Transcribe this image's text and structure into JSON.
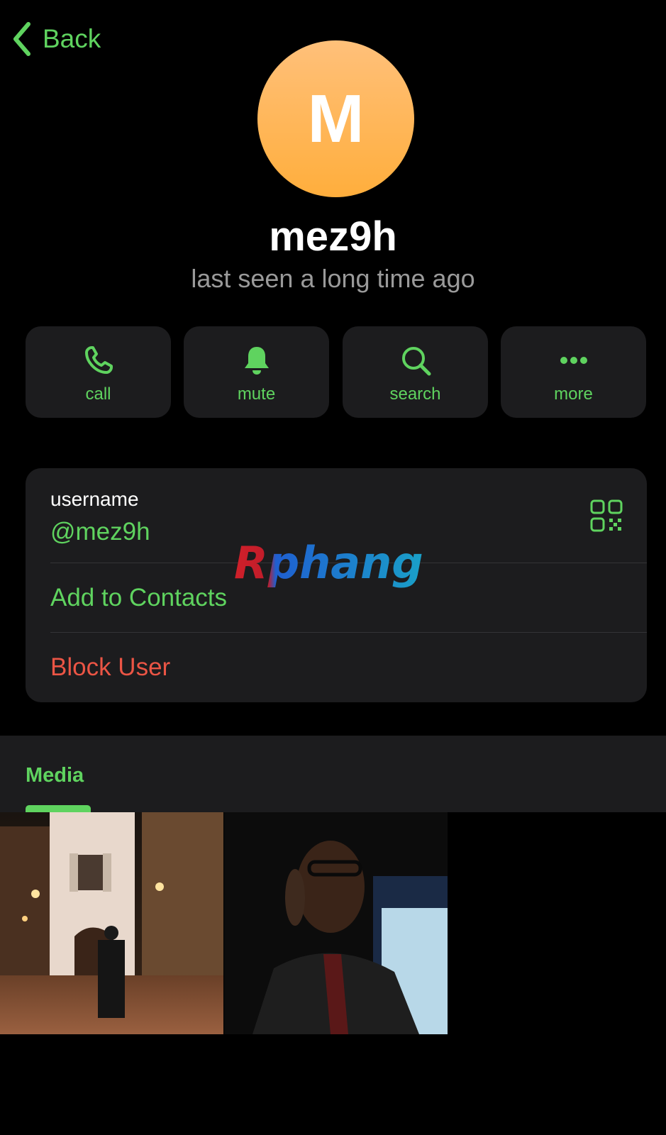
{
  "nav": {
    "back_label": "Back"
  },
  "profile": {
    "avatar_initial": "M",
    "name": "mez9h",
    "status": "last seen a long time ago"
  },
  "actions": [
    {
      "label": "call",
      "icon": "phone-icon"
    },
    {
      "label": "mute",
      "icon": "bell-icon"
    },
    {
      "label": "search",
      "icon": "search-icon"
    },
    {
      "label": "more",
      "icon": "more-dots-icon"
    }
  ],
  "info": {
    "username_label": "username",
    "username_value": "@mez9h",
    "add_contacts": "Add to Contacts",
    "block_user": "Block User"
  },
  "watermark": {
    "text": "Rphang"
  },
  "media": {
    "tab_label": "Media",
    "items": [
      {
        "icon": "night-street-photo"
      },
      {
        "icon": "portrait-photo"
      }
    ]
  },
  "colors": {
    "accent": "#5fd35f",
    "danger": "#eb5545",
    "card": "#1c1c1e",
    "background": "#000000",
    "avatar": "#ffae3c"
  }
}
